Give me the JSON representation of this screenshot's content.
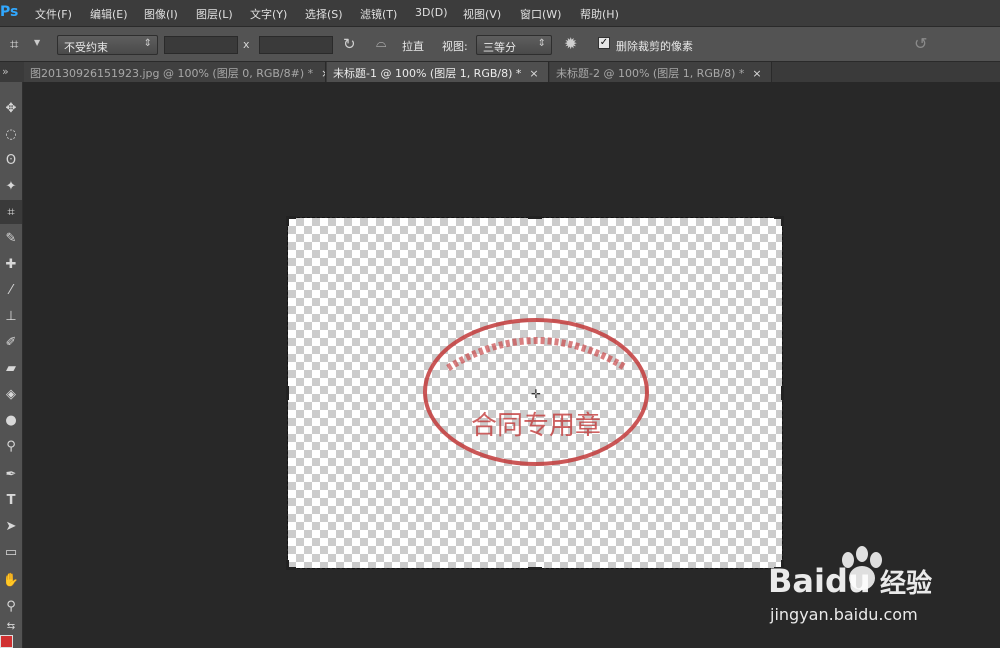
{
  "app": {
    "logo": "Ps"
  },
  "menu": [
    "文件(F)",
    "编辑(E)",
    "图像(I)",
    "图层(L)",
    "文字(Y)",
    "选择(S)",
    "滤镜(T)",
    "3D(D)",
    "视图(V)",
    "窗口(W)",
    "帮助(H)"
  ],
  "options": {
    "ratio_select": "不受约束",
    "x_sep": "x",
    "straighten_label": "拉直",
    "view_label": "视图:",
    "view_select": "三等分",
    "delete_cropped_label": "删除裁剪的像素",
    "delete_cropped_checked": true
  },
  "tabs": [
    {
      "title": "图20130926151923.jpg @ 100% (图层 0, RGB/8#) *",
      "close": "×",
      "active": false
    },
    {
      "title": "未标题-1 @ 100% (图层 1, RGB/8) *",
      "close": "×",
      "active": true
    },
    {
      "title": "未标题-2 @ 100% (图层 1, RGB/8) *",
      "close": "×",
      "active": false
    }
  ],
  "tab_strip_arrows": "»",
  "canvas": {
    "stamp_text": "合同专用章",
    "stamp_color": "#c23a3a"
  },
  "watermark": {
    "brand": "Baidu",
    "product": "经验",
    "url": "jingyan.baidu.com"
  },
  "colors": {
    "foreground": "#d03030"
  }
}
